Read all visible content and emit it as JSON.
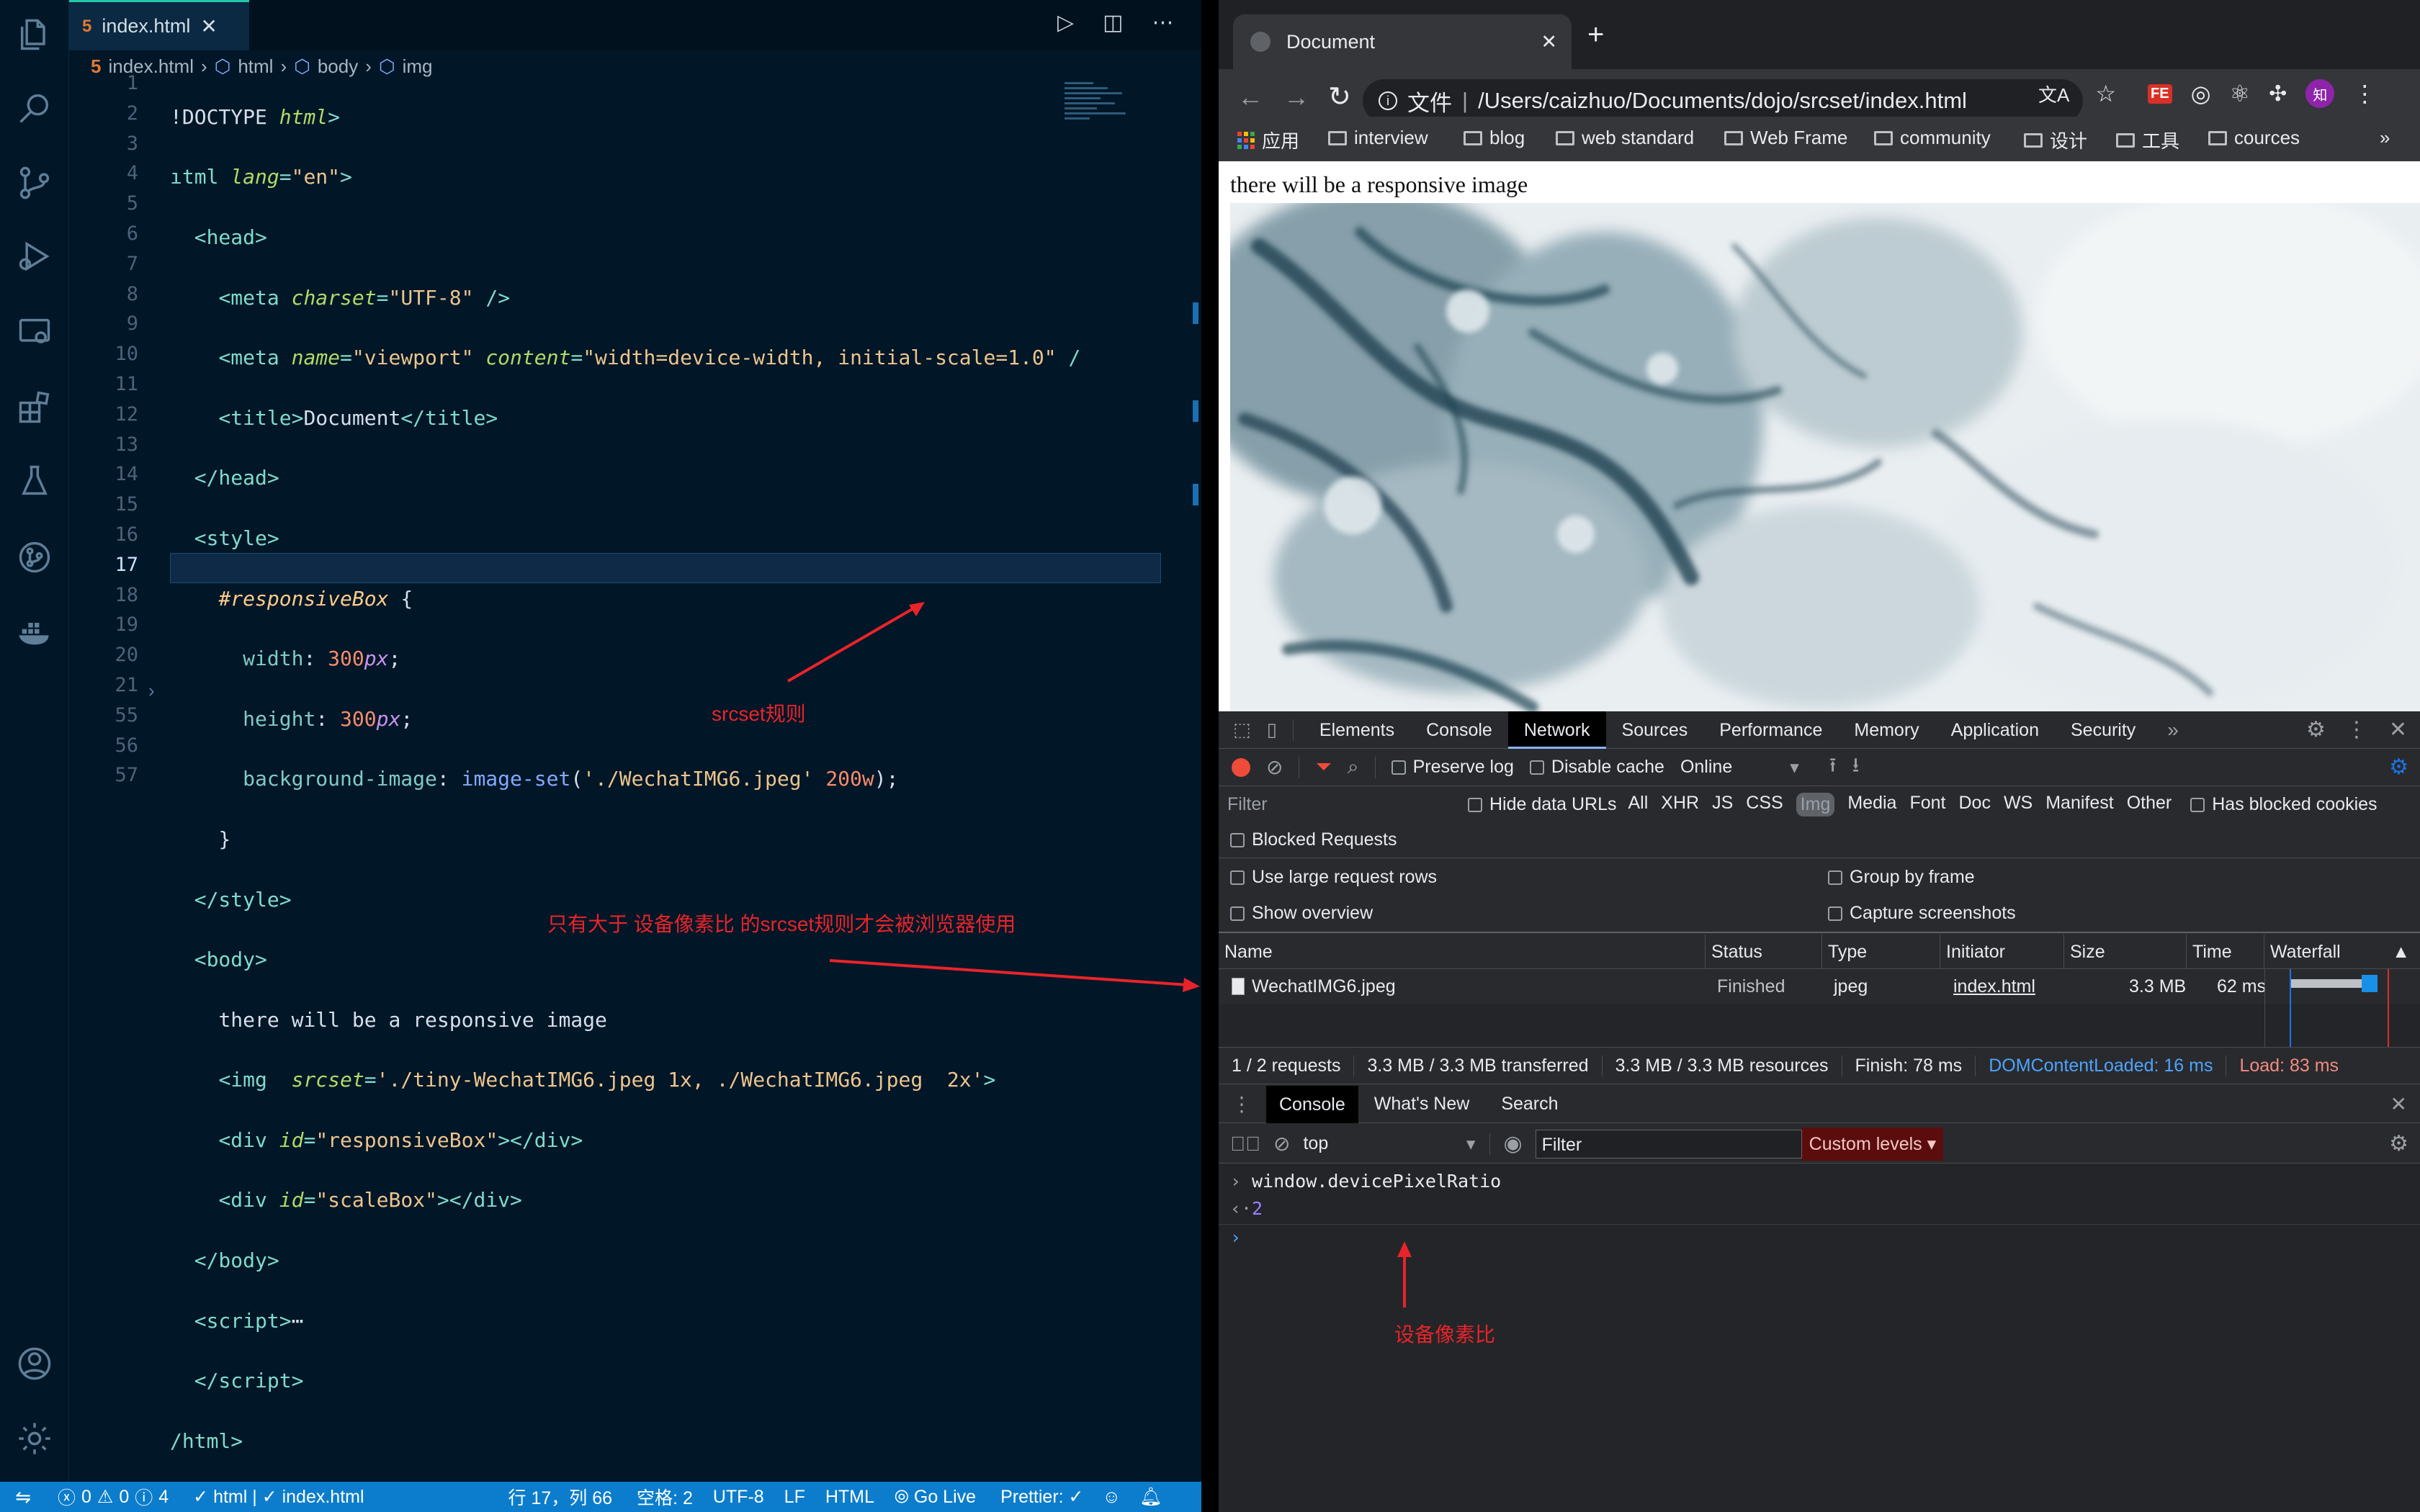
{
  "vscode": {
    "tab_label": "index.html",
    "breadcrumb": [
      "index.html",
      "html",
      "body",
      "img"
    ],
    "line_numbers": [
      "1",
      "2",
      "3",
      "4",
      "5",
      "6",
      "7",
      "8",
      "9",
      "10",
      "11",
      "12",
      "13",
      "14",
      "15",
      "16",
      "17",
      "18",
      "19",
      "20",
      "21",
      "55",
      "56",
      "57"
    ],
    "annotations": {
      "srcset_rule": "srcset规则",
      "only_larger": "只有大于 设备像素比 的srcset规则才会被浏览器使用"
    },
    "status": {
      "errors": "0",
      "warnings": "0",
      "info": "4",
      "html_check": "html | ✓ index.html",
      "position": "行 17，列 66",
      "spaces": "空格: 2",
      "encoding": "UTF-8",
      "eol": "LF",
      "language": "HTML",
      "go_live": "Go Live",
      "prettier": "Prettier: ✓"
    }
  },
  "browser": {
    "tab_title": "Document",
    "omnibox_scheme": "文件",
    "omnibox_url": "/Users/caizhuo/Documents/dojo/srcset/index.html",
    "bookmarks": [
      "应用",
      "interview",
      "blog",
      "web standard",
      "Web Frame",
      "community",
      "设计",
      "工具",
      "cources"
    ],
    "page_text": "there will be a responsive image",
    "devtools": {
      "tabs": [
        "Elements",
        "Console",
        "Network",
        "Sources",
        "Performance",
        "Memory",
        "Application",
        "Security"
      ],
      "active_tab": "Network",
      "toolbar": {
        "preserve_log": "Preserve log",
        "disable_cache": "Disable cache",
        "throttle": "Online"
      },
      "filter_placeholder": "Filter",
      "hide_data_urls": "Hide data URLs",
      "type_filters": [
        "All",
        "XHR",
        "JS",
        "CSS",
        "Img",
        "Media",
        "Font",
        "Doc",
        "WS",
        "Manifest",
        "Other"
      ],
      "has_blocked_cookies": "Has blocked cookies",
      "blocked_requests": "Blocked Requests",
      "use_large_rows": "Use large request rows",
      "group_by_frame": "Group by frame",
      "show_overview": "Show overview",
      "capture_screenshots": "Capture screenshots",
      "columns": [
        "Name",
        "Status",
        "Type",
        "Initiator",
        "Size",
        "Time",
        "Waterfall"
      ],
      "row": {
        "name": "WechatIMG6.jpeg",
        "status": "Finished",
        "type": "jpeg",
        "initiator": "index.html",
        "size": "3.3 MB",
        "time": "62 ms"
      },
      "summary": {
        "requests": "1 / 2 requests",
        "transferred": "3.3 MB / 3.3 MB transferred",
        "resources": "3.3 MB / 3.3 MB resources",
        "finish": "Finish: 78 ms",
        "dcl": "DOMContentLoaded: 16 ms",
        "load": "Load: 83 ms"
      },
      "drawer_tabs": [
        "Console",
        "What's New",
        "Search"
      ],
      "console": {
        "context": "top",
        "filter_placeholder": "Filter",
        "levels": "Custom levels",
        "input": "window.devicePixelRatio",
        "output": "2",
        "annotation": "设备像素比"
      }
    }
  },
  "colors": {
    "accent": "#21c7a8",
    "statusbar": "#0c7dcc",
    "annotation": "#e8242a"
  }
}
